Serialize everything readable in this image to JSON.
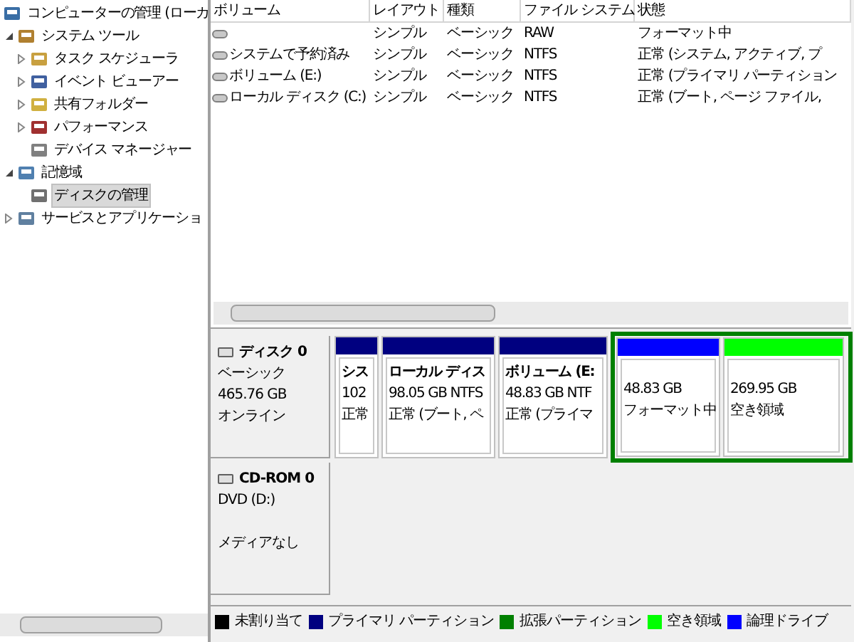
{
  "tree": [
    {
      "label": "コンピューターの管理 (ローカ",
      "children": [
        {
          "label": "システム ツール",
          "expanded": true,
          "selected": false,
          "children": [
            {
              "label": "タスク スケジューラ",
              "expanded": false,
              "selected": false
            },
            {
              "label": "イベント ビューアー",
              "expanded": false,
              "selected": false
            },
            {
              "label": "共有フォルダー",
              "expanded": false,
              "selected": false
            },
            {
              "label": "パフォーマンス",
              "expanded": false,
              "selected": false
            },
            {
              "label": "デバイス マネージャー",
              "selected": false
            }
          ]
        },
        {
          "label": "記憶域",
          "expanded": true,
          "selected": false,
          "children": [
            {
              "label": "ディスクの管理",
              "selected": true
            }
          ]
        },
        {
          "label": "サービスとアプリケーショ",
          "expanded": false,
          "selected": false
        }
      ]
    }
  ],
  "volumes": {
    "columns": [
      "ボリューム",
      "レイアウト",
      "種類",
      "ファイル システム",
      "状態"
    ],
    "rows": [
      [
        "",
        "シンプル",
        "ベーシック",
        "RAW",
        "フォーマット中"
      ],
      [
        "システムで予約済み",
        "シンプル",
        "ベーシック",
        "NTFS",
        "正常 (システム, アクティブ, プ"
      ],
      [
        "ボリューム (E:)",
        "シンプル",
        "ベーシック",
        "NTFS",
        "正常 (プライマリ パーティション"
      ],
      [
        "ローカル ディスク (C:)",
        "シンプル",
        "ベーシック",
        "NTFS",
        "正常 (ブート, ページ ファイル,"
      ]
    ]
  },
  "disks": [
    {
      "kind": "disk",
      "name": "ディスク 0",
      "lines": [
        "ベーシック",
        "465.76 GB",
        "オンライン"
      ],
      "partitions": [
        {
          "kind": "primary",
          "lines": [
            "シス",
            "102",
            "正常"
          ]
        },
        {
          "kind": "primary",
          "lines": [
            "ローカル ディス",
            "98.05 GB NTFS",
            "正常 (ブート, ペ"
          ]
        },
        {
          "kind": "primary",
          "lines": [
            "ボリューム (E:",
            "48.83 GB NTF",
            "正常 (プライマ"
          ]
        },
        {
          "kind": "logical",
          "lines": [
            "48.83 GB",
            "フォーマット中"
          ]
        },
        {
          "kind": "free",
          "lines": [
            "269.95 GB",
            "空き領域"
          ]
        }
      ]
    },
    {
      "kind": "cdrom",
      "name": "CD-ROM 0",
      "lines": [
        "DVD (D:)",
        "メディアなし"
      ]
    }
  ],
  "legend": [
    {
      "label": "未割り当て",
      "color": "#000000"
    },
    {
      "label": "プライマリ パーティション",
      "color": "#000080"
    },
    {
      "label": "拡張パーティション",
      "color": "#008000"
    },
    {
      "label": "空き領域",
      "color": "#00ff00"
    },
    {
      "label": "論理ドライブ",
      "color": "#0000ff"
    }
  ]
}
